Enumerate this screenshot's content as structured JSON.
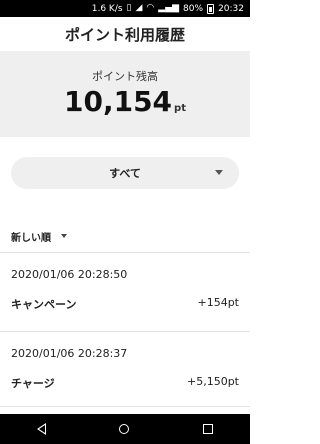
{
  "status_bar": {
    "network_speed": "1.6 K/s",
    "battery_percent": "80%",
    "time": "20:32"
  },
  "header": {
    "title": "ポイント利用履歴"
  },
  "balance": {
    "label": "ポイント残高",
    "value": "10,154",
    "unit": "pt"
  },
  "filter": {
    "selected": "すべて"
  },
  "sort": {
    "selected": "新しい順"
  },
  "history": [
    {
      "datetime": "2020/01/06 20:28:50",
      "name": "キャンペーン",
      "points": "+154pt"
    },
    {
      "datetime": "2020/01/06 20:28:37",
      "name": "チャージ",
      "points": "+5,150pt"
    }
  ],
  "icons": {
    "signal": "signal-icon",
    "wifi": "wifi-icon",
    "battery": "battery-icon",
    "nav_back": "back-icon",
    "nav_home": "home-icon",
    "nav_recent": "recent-apps-icon"
  }
}
